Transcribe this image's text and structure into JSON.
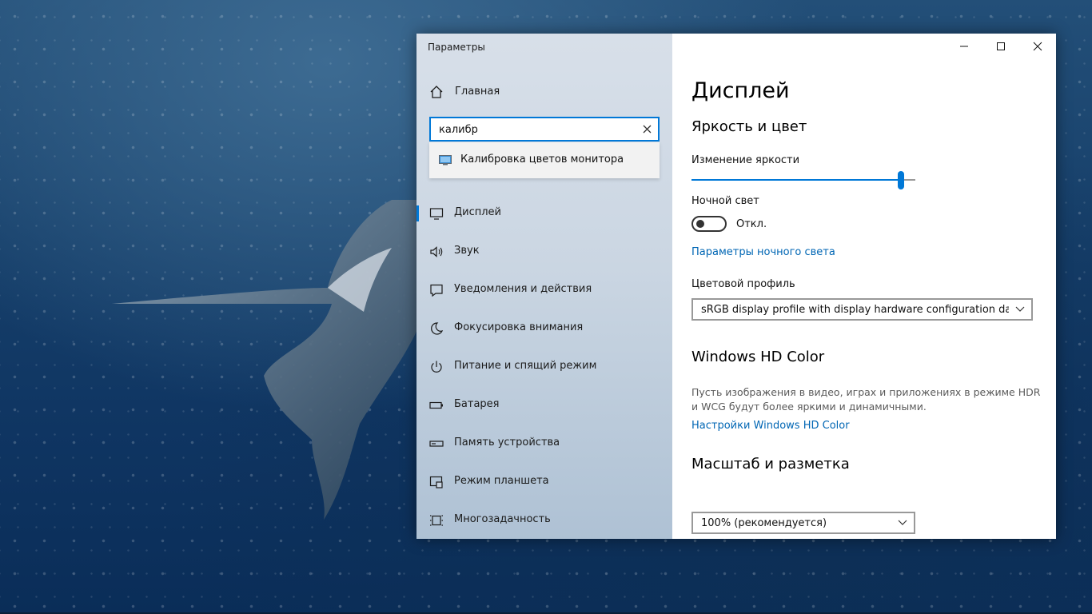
{
  "window": {
    "app_title": "Параметры",
    "buttons": {
      "minimize": "minimize",
      "maximize": "maximize",
      "close": "close"
    }
  },
  "sidebar": {
    "home_label": "Главная",
    "search": {
      "value": "калибр",
      "placeholder": ""
    },
    "suggestion": {
      "label": "Калибровка цветов монитора",
      "icon": "monitor-icon"
    },
    "items": [
      {
        "label": "Дисплей",
        "icon": "display-icon",
        "selected": true
      },
      {
        "label": "Звук",
        "icon": "speaker-icon"
      },
      {
        "label": "Уведомления и действия",
        "icon": "notification-icon"
      },
      {
        "label": "Фокусировка внимания",
        "icon": "moon-icon"
      },
      {
        "label": "Питание и спящий режим",
        "icon": "power-icon"
      },
      {
        "label": "Батарея",
        "icon": "battery-icon"
      },
      {
        "label": "Память устройства",
        "icon": "storage-icon"
      },
      {
        "label": "Режим планшета",
        "icon": "tablet-icon"
      },
      {
        "label": "Многозадачность",
        "icon": "multitask-icon"
      }
    ]
  },
  "content": {
    "title": "Дисплей",
    "brightness_section": "Яркость и цвет",
    "brightness_label": "Изменение яркости",
    "brightness_value": 0.95,
    "night_light_label": "Ночной свет",
    "night_light_state": "Откл.",
    "night_light_settings_link": "Параметры ночного света",
    "color_profile_label": "Цветовой профиль",
    "color_profile_value": "sRGB display profile with display hardware configuration dat...",
    "hdr_section": "Windows HD Color",
    "hdr_description": "Пусть изображения в видео, играх и приложениях в режиме HDR и WCG будут более яркими и динамичными.",
    "hdr_settings_link": "Настройки Windows HD Color",
    "scale_section": "Масштаб и разметка",
    "scale_value": "100% (рекомендуется)"
  },
  "colors": {
    "accent": "#0078d7",
    "link": "#0066b4"
  }
}
